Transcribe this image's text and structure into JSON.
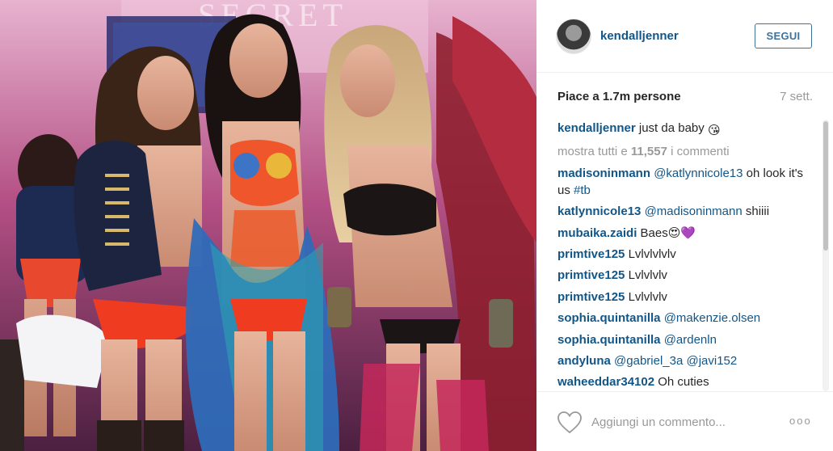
{
  "post": {
    "username": "kendalljenner",
    "follow_label": "SEGUI",
    "likes_text": "Piace a 1.7m persone",
    "date": "7 sett.",
    "photo_sign_text": "SECRET"
  },
  "caption": {
    "user": "kendalljenner",
    "text": "just da baby",
    "emoji": "😘"
  },
  "show_all": {
    "prefix": "mostra tutti e ",
    "count": "11,557",
    "suffix": " i commenti"
  },
  "comments": [
    {
      "user": "madisoninmann",
      "mention": "@katlynnicole13",
      "text": " oh look it's us ",
      "tag": "#tb"
    },
    {
      "user": "katlynnicole13",
      "mention": "@madisoninmann",
      "text": " shiiii",
      "tag": ""
    },
    {
      "user": "mubaika.zaidi",
      "mention": "",
      "text": "Baes😍💜",
      "tag": ""
    },
    {
      "user": "primtive125",
      "mention": "",
      "text": "Lvlvlvlvlv",
      "tag": ""
    },
    {
      "user": "primtive125",
      "mention": "",
      "text": "Lvlvlvlv",
      "tag": ""
    },
    {
      "user": "primtive125",
      "mention": "",
      "text": "Lvlvlvlv",
      "tag": ""
    },
    {
      "user": "sophia.quintanilla",
      "mention": "@makenzie.olsen",
      "text": "",
      "tag": ""
    },
    {
      "user": "sophia.quintanilla",
      "mention": "@ardenln",
      "text": "",
      "tag": ""
    },
    {
      "user": "andyluna",
      "mention": "@gabriel_3a @javi152",
      "text": "",
      "tag": ""
    },
    {
      "user": "waheeddar34102",
      "mention": "",
      "text": "Oh cuties",
      "tag": ""
    }
  ],
  "footer": {
    "comment_placeholder": "Aggiungi un commento...",
    "more_label": "ooo",
    "heart_icon": "heart-outline-icon"
  },
  "colors": {
    "link_blue": "#125688",
    "follow_blue": "#3f729b",
    "muted_gray": "#999999"
  }
}
